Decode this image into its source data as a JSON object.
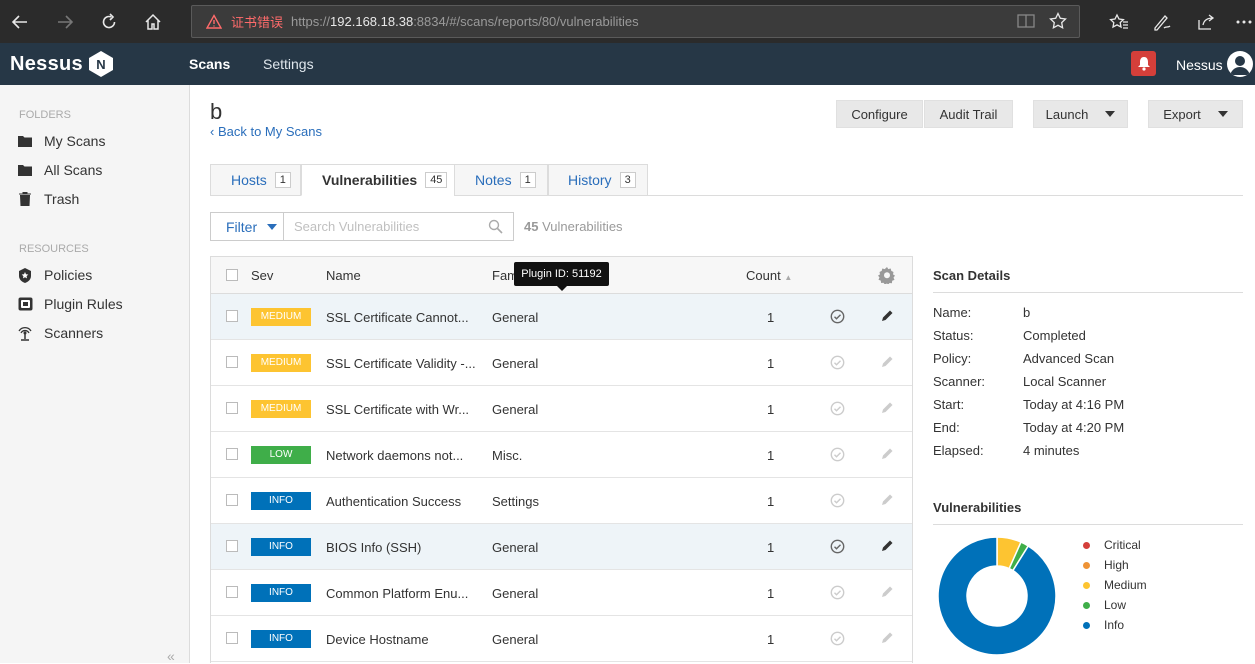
{
  "browser": {
    "cert_error": "证书错误",
    "url_prefix": "https://",
    "url_host": "192.168.18.38",
    "url_rest": ":8834/#/scans/reports/80/vulnerabilities"
  },
  "nav": {
    "logo": "Nessus",
    "logo_badge": "N",
    "scans": "Scans",
    "settings": "Settings",
    "user": "Nessus"
  },
  "sidebar": {
    "folders_heading": "FOLDERS",
    "folders": [
      {
        "label": "My Scans",
        "icon": "folder-icon"
      },
      {
        "label": "All Scans",
        "icon": "folder-icon"
      },
      {
        "label": "Trash",
        "icon": "trash-icon"
      }
    ],
    "resources_heading": "RESOURCES",
    "resources": [
      {
        "label": "Policies",
        "icon": "shield-icon"
      },
      {
        "label": "Plugin Rules",
        "icon": "plugin-icon"
      },
      {
        "label": "Scanners",
        "icon": "radar-icon"
      }
    ],
    "collapse": "«"
  },
  "header": {
    "title": "b",
    "back": "Back to My Scans",
    "buttons": {
      "configure": "Configure",
      "audit": "Audit Trail",
      "launch": "Launch",
      "export": "Export"
    }
  },
  "tabs": [
    {
      "label": "Hosts",
      "count": "1"
    },
    {
      "label": "Vulnerabilities",
      "count": "45"
    },
    {
      "label": "Notes",
      "count": "1"
    },
    {
      "label": "History",
      "count": "3"
    }
  ],
  "filter": {
    "label": "Filter",
    "placeholder": "Search Vulnerabilities",
    "count": "45",
    "count_label": "Vulnerabilities"
  },
  "table": {
    "columns": {
      "sev": "Sev",
      "name": "Name",
      "family": "Family",
      "count": "Count"
    },
    "tooltip": "Plugin ID: 51192",
    "rows": [
      {
        "sev": "MEDIUM",
        "name": "SSL Certificate Cannot...",
        "family": "General",
        "count": "1"
      },
      {
        "sev": "MEDIUM",
        "name": "SSL Certificate Validity -...",
        "family": "General",
        "count": "1"
      },
      {
        "sev": "MEDIUM",
        "name": "SSL Certificate with Wr...",
        "family": "General",
        "count": "1"
      },
      {
        "sev": "LOW",
        "name": "Network daemons not...",
        "family": "Misc.",
        "count": "1"
      },
      {
        "sev": "INFO",
        "name": "Authentication Success",
        "family": "Settings",
        "count": "1"
      },
      {
        "sev": "INFO",
        "name": "BIOS Info (SSH)",
        "family": "General",
        "count": "1"
      },
      {
        "sev": "INFO",
        "name": "Common Platform Enu...",
        "family": "General",
        "count": "1"
      },
      {
        "sev": "INFO",
        "name": "Device Hostname",
        "family": "General",
        "count": "1"
      }
    ]
  },
  "scan_details": {
    "heading": "Scan Details",
    "items": [
      {
        "label": "Name:",
        "value": "b"
      },
      {
        "label": "Status:",
        "value": "Completed"
      },
      {
        "label": "Policy:",
        "value": "Advanced Scan"
      },
      {
        "label": "Scanner:",
        "value": "Local Scanner"
      },
      {
        "label": "Start:",
        "value": "Today at 4:16 PM"
      },
      {
        "label": "End:",
        "value": "Today at 4:20 PM"
      },
      {
        "label": "Elapsed:",
        "value": "4 minutes"
      }
    ]
  },
  "vulnerabilities_chart": {
    "heading": "Vulnerabilities",
    "legend": [
      {
        "label": "Critical",
        "color": "#d43f3a"
      },
      {
        "label": "High",
        "color": "#ee9336"
      },
      {
        "label": "Medium",
        "color": "#fdc431"
      },
      {
        "label": "Low",
        "color": "#3fae49"
      },
      {
        "label": "Info",
        "color": "#0071b9"
      }
    ],
    "slices": [
      {
        "label": "Medium",
        "value": 3
      },
      {
        "label": "Low",
        "value": 1
      },
      {
        "label": "Info",
        "value": 41
      }
    ]
  },
  "colors": {
    "medium": "#fdc431",
    "low": "#3fae49",
    "info": "#0071b9"
  }
}
